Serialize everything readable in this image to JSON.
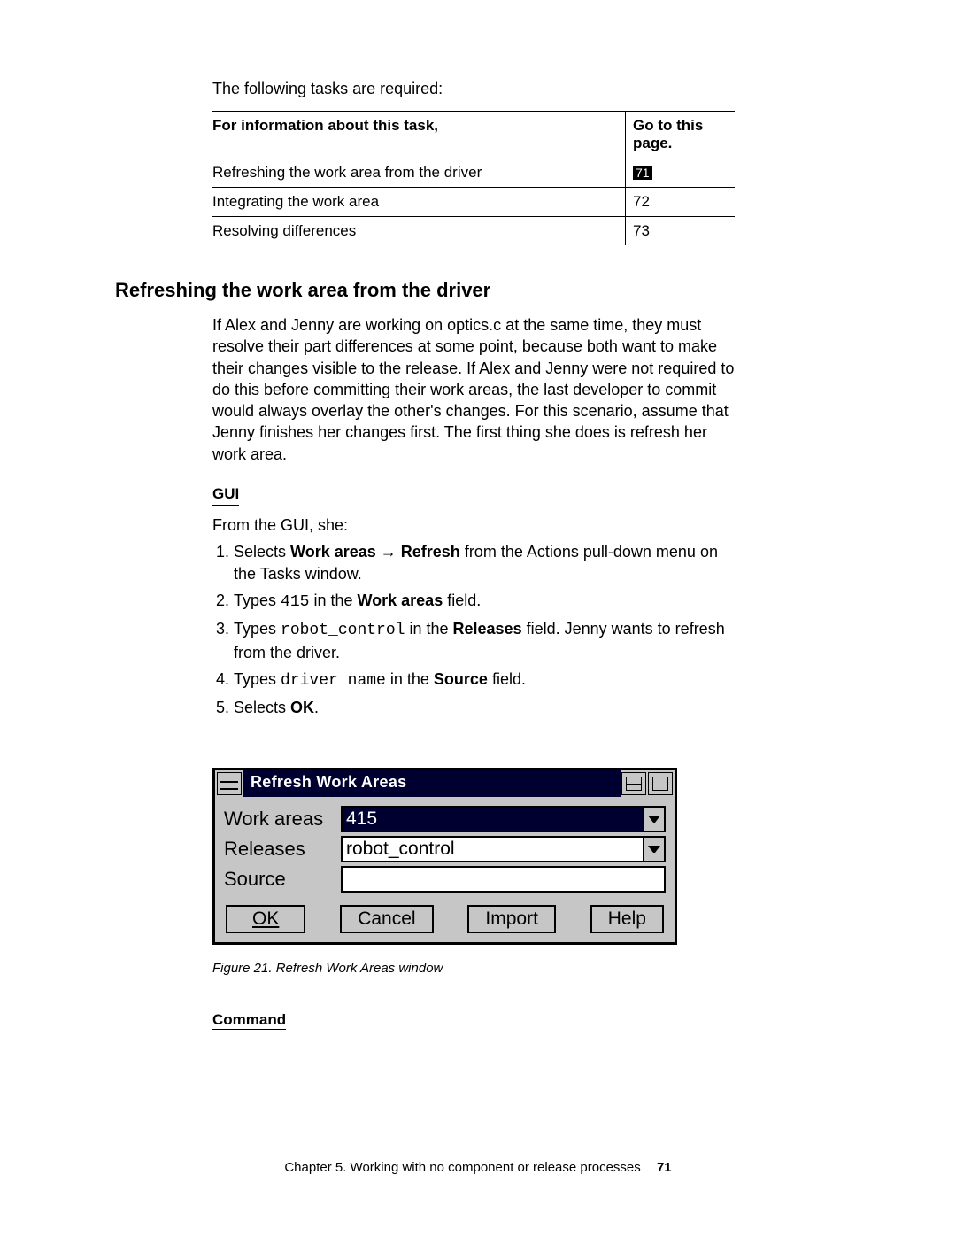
{
  "intro": "The following tasks are required:",
  "table": {
    "col1": "For information about this task,",
    "col2": "Go to this page.",
    "rows": [
      {
        "task": "Refreshing the work area from the driver",
        "page": "71",
        "link": true
      },
      {
        "task": "Integrating the work area",
        "page": "72",
        "link": false
      },
      {
        "task": "Resolving differences",
        "page": "73",
        "link": false
      }
    ]
  },
  "heading": "Refreshing the work area from the driver",
  "para": "If Alex and Jenny are working on optics.c at the same time, they must resolve their part differences at some point, because both want to make their changes visible to the release. If Alex and Jenny were not required to do this before committing their work areas, the last developer to commit would always overlay the other's changes. For this scenario, assume that Jenny finishes her changes first. The first thing she does is refresh her work area.",
  "gui": {
    "label": "GUI",
    "lead": "From the GUI, she:",
    "steps": {
      "s1a": "Selects ",
      "s1b": "Work areas",
      "s1arrow": " → ",
      "s1c": "Refresh",
      "s1d": " from the Actions pull-down menu on the Tasks window.",
      "s2a": "Types ",
      "s2code": "415",
      "s2b": " in the ",
      "s2bold": "Work areas",
      "s2c": " field.",
      "s3a": "Types ",
      "s3code": "robot_control",
      "s3b": " in the ",
      "s3bold": "Releases",
      "s3c": " field. Jenny wants to refresh from the driver.",
      "s4a": "Types ",
      "s4code": "driver name",
      "s4b": " in the ",
      "s4bold": "Source",
      "s4c": " field.",
      "s5a": "Selects ",
      "s5bold": "OK",
      "s5b": "."
    }
  },
  "dialog": {
    "title": "Refresh Work Areas",
    "labels": {
      "workareas": "Work areas",
      "releases": "Releases",
      "source": "Source"
    },
    "values": {
      "workareas": "415",
      "releases": "robot_control",
      "source": ""
    },
    "buttons": {
      "ok": "OK",
      "cancel": "Cancel",
      "import": "Import",
      "help": "Help"
    }
  },
  "caption": "Figure 21. Refresh Work Areas window",
  "command": "Command",
  "footer": {
    "chapter": "Chapter 5. Working with no component or release processes",
    "page": "71"
  }
}
